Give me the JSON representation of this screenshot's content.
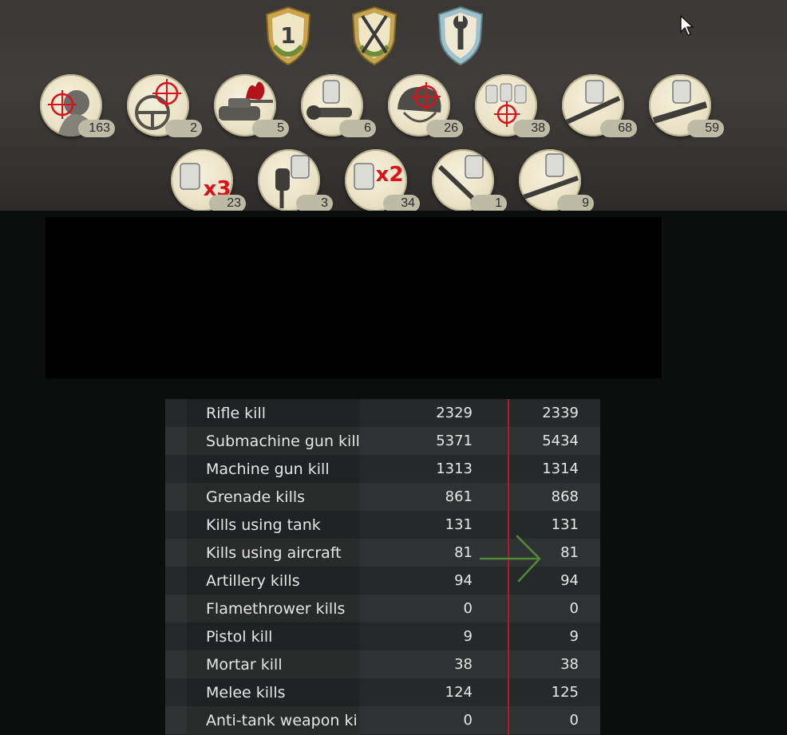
{
  "awards": {
    "shields": [
      {
        "icon": "first-place-shield-icon",
        "glyph": "1"
      },
      {
        "icon": "crossed-rifles-shield-icon"
      },
      {
        "icon": "wrench-shield-icon"
      }
    ],
    "medals_row1": [
      {
        "icon": "soldier-target-medal-icon",
        "count": "163"
      },
      {
        "icon": "steering-wheel-target-medal-icon",
        "count": "2"
      },
      {
        "icon": "burning-tank-medal-icon",
        "count": "5"
      },
      {
        "icon": "scope-dogtag-medal-icon",
        "count": "6"
      },
      {
        "icon": "helmet-target-medal-icon",
        "count": "26"
      },
      {
        "icon": "dogtags-target-medal-icon",
        "count": "38"
      },
      {
        "icon": "rifle-dogtag-medal-icon",
        "count": "68"
      },
      {
        "icon": "launcher-dogtag-medal-icon",
        "count": "59"
      }
    ],
    "medals_row2": [
      {
        "icon": "dogtag-x3-medal-icon",
        "mult": "x3",
        "count": "23"
      },
      {
        "icon": "grenade-dogtag-medal-icon",
        "count": "3"
      },
      {
        "icon": "dogtag-x2-medal-icon",
        "mult": "x2",
        "count": "34"
      },
      {
        "icon": "knife-dogtag-medal-icon",
        "count": "1"
      },
      {
        "icon": "gun-dogtag-medal-icon",
        "count": "9"
      }
    ]
  },
  "stats": [
    {
      "label": "Rifle kill",
      "before": "2329",
      "after": "2339"
    },
    {
      "label": "Submachine gun kill",
      "before": "5371",
      "after": "5434"
    },
    {
      "label": "Machine gun kill",
      "before": "1313",
      "after": "1314"
    },
    {
      "label": "Grenade kills",
      "before": "861",
      "after": "868"
    },
    {
      "label": "Kills using tank",
      "before": "131",
      "after": "131"
    },
    {
      "label": "Kills using aircraft",
      "before": "81",
      "after": "81"
    },
    {
      "label": "Artillery kills",
      "before": "94",
      "after": "94"
    },
    {
      "label": "Flamethrower kills",
      "before": "0",
      "after": "0"
    },
    {
      "label": "Pistol kill",
      "before": "9",
      "after": "9"
    },
    {
      "label": "Mortar kill",
      "before": "38",
      "after": "38"
    },
    {
      "label": "Melee kills",
      "before": "124",
      "after": "125"
    },
    {
      "label": "Anti-tank weapon ki",
      "before": "0",
      "after": "0"
    }
  ],
  "colors": {
    "divider": "#b21b26",
    "arrow": "#4f8a37",
    "target": "#d8121d"
  }
}
